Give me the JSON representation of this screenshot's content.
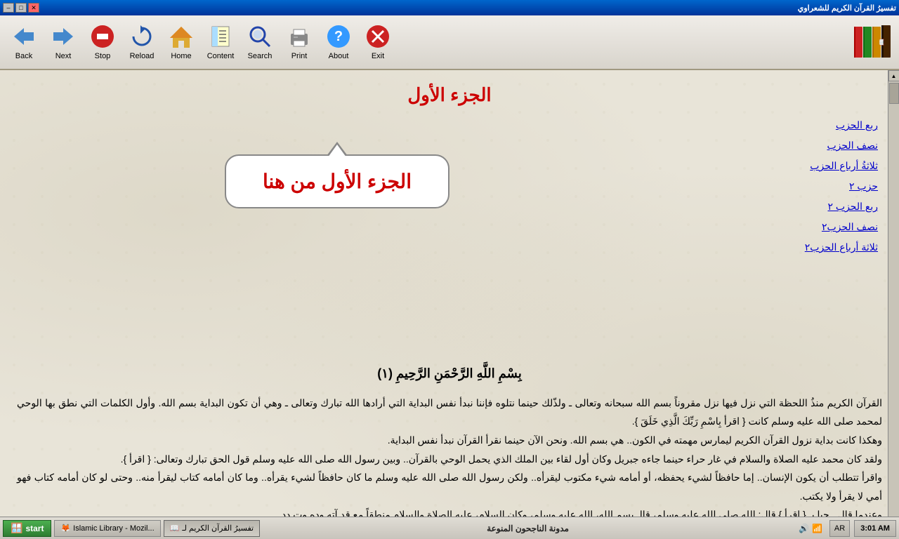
{
  "titlebar": {
    "title": "تفسيرُ القرآن الكريم للشعراوي",
    "btn_minimize": "–",
    "btn_maximize": "□",
    "btn_close": "✕"
  },
  "toolbar": {
    "back_label": "Back",
    "next_label": "Next",
    "stop_label": "Stop",
    "reload_label": "Reload",
    "home_label": "Home",
    "content_label": "Content",
    "search_label": "Search",
    "print_label": "Print",
    "about_label": "About",
    "exit_label": "Exit"
  },
  "page": {
    "title": "الجزء الأول",
    "nav_links": [
      "ربع الحزب",
      "نصف الحزب",
      "ثلاثةُ أرباع الحزب",
      "حزب ٢",
      "ربع الحزب ٢",
      "نصف الحزب٢",
      "ثلاثة أرباع الحزب٢"
    ],
    "bubble_text": "الجزء الأول من هنا",
    "basmala": "بِسْمِ اللَّهِ الرَّحْمَنِ الرَّحِيمِ (١)",
    "paragraph1": "القرآن الكريم منذُ اللحظة التي نزل فيها نزل مقروناً بسم الله سبحانه وتعالى ـ ولذّلك حينما نتلوه فإننا نبدأ نفس البداية التي أرادها الله تبارك وتعالى ـ وهي أن تكون البداية بسم الله. وأول الكلمات التي نطق بها الوحي لمحمد صلى الله عليه وسلم كانت { اقرأ بِاسْمِ رَبِّكَ الَّذِي خَلَقَ }.",
    "paragraph2": "وهكذا كانت بداية نزول القرآن الكريم ليمارس مهمته في الكون.. هي بسم الله. ونحن الآن حينما نقرأ القرآن نبدأ نفس البداية.",
    "paragraph3": "ولقد كان محمد عليه الصلاة والسلام في غار حراء حينما جاءه جبريل وكان أول لقاء بين الملك الذي يحمل الوحي بالقرآن.. وبين رسول الله صلى الله عليه وسلم قول الحق تبارك وتعالى: { اقرأ }.",
    "paragraph4": "واقرأ تتطلب أن يكون الإنسان.. إما حافظاً لشيء يحفظه، أو أمامه شيء مكتوب ليقرأه.. ولكن رسول الله صلى الله عليه وسلم ما كان حافظاً لشيء يقرأه.. وما كان أمامه كتاب ليقرأ منه.. وحتى لو كان أمامه كتاب فهو أمي لا يقرأ ولا يكتب.",
    "paragraph5": "وعندما قال ـ حبا بـ { اقرأ } قال: الله صلى الله عليه وسلم، قالـ يسم الله، الله عليه وسلم، وكان السلام، عليه الصلاة والسلام منطقاً مع قد آته وده وت دد"
  },
  "taskbar": {
    "start_label": "start",
    "items": [
      {
        "label": "Islamic Library - Mozil...",
        "icon": "🦊"
      },
      {
        "label": "تفسيرُ القرآن الكريم لـ",
        "icon": "📖"
      }
    ],
    "center_text": "مدونة الناجحون المنوعة",
    "language": "AR",
    "clock": "3:01 AM"
  }
}
